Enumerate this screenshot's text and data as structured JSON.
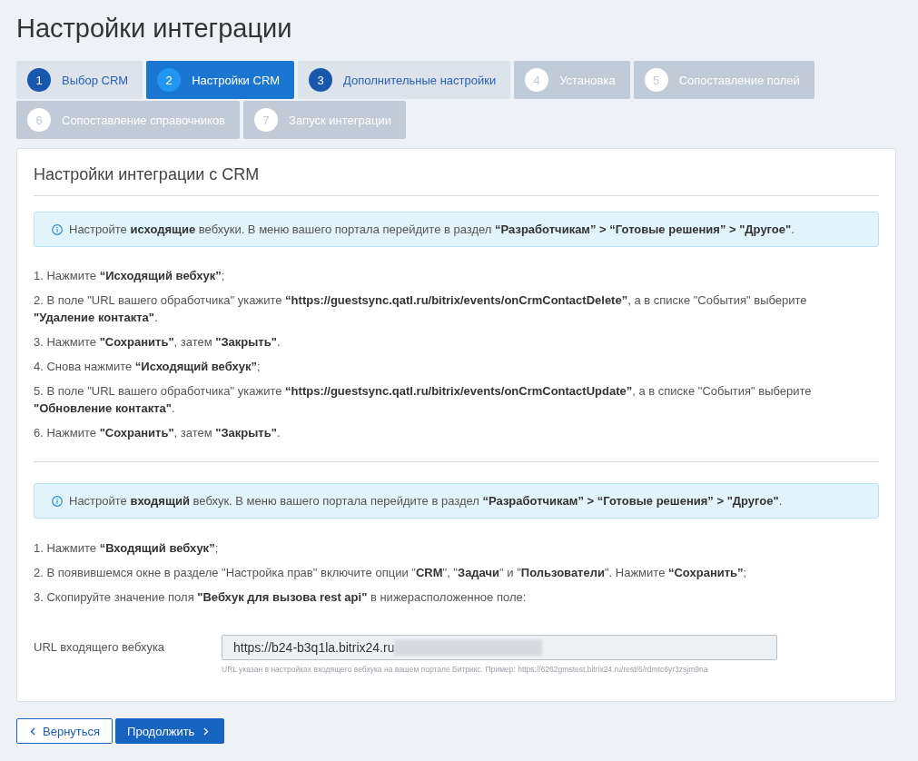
{
  "page": {
    "title": "Настройки интеграции"
  },
  "tabs": [
    {
      "number": "1",
      "label": "Выбор CRM",
      "selected": false,
      "disabled": false
    },
    {
      "number": "2",
      "label": "Настройки CRM",
      "selected": true,
      "disabled": false
    },
    {
      "number": "3",
      "label": "Дополнительные настройки",
      "selected": false,
      "disabled": false
    },
    {
      "number": "4",
      "label": "Установка",
      "selected": false,
      "disabled": true
    },
    {
      "number": "5",
      "label": "Сопоставление полей",
      "selected": false,
      "disabled": true
    },
    {
      "number": "6",
      "label": "Сопоставление справочников",
      "selected": false,
      "disabled": true
    },
    {
      "number": "7",
      "label": "Запуск интеграции",
      "selected": false,
      "disabled": true
    }
  ],
  "card": {
    "title": "Настройки интеграции с CRM",
    "sections": [
      {
        "notice": "Настройте **исходящие** вебхуки. В меню вашего портала перейдите в раздел **“Разработчикам” > “Готовые решения” > \"Другое\"**.",
        "steps": [
          "1. Нажмите **“Исходящий вебхук”**;",
          "2. В поле \"URL вашего обработчика\" укажите **“https://guestsync.qatl.ru/bitrix/events/onCrmContactDelete”**, а в списке \"События\" выберите **\"Удаление контакта\"**.",
          "3. Нажмите **\"Сохранить\"**, затем **\"Закрыть\"**.",
          "4. Снова нажмите **“Исходящий вебхук”**;",
          "5. В поле \"URL вашего обработчика\" укажите **“https://guestsync.qatl.ru/bitrix/events/onCrmContactUpdate”**, а в списке \"События\" выберите **\"Обновление контакта\"**.",
          "6. Нажмите **\"Сохранить\"**, затем **\"Закрыть\"**."
        ]
      },
      {
        "notice": "Настройте **входящий** вебхук. В меню вашего портала перейдите в раздел **“Разработчикам” > “Готовые решения” > \"Другое\"**.",
        "steps": [
          "1. Нажмите **“Входящий вебхук”**;",
          "2. В появившемся окне в разделе \"Настройка прав\" включите опции \"**CRM**\", \"**Задачи**\" и \"**Пользователи**\". Нажмите **“Сохранить”**;",
          "3. Скопируйте значение поля **\"Вебхук для вызова rest api\"** в нижерасположенное поле:"
        ]
      }
    ],
    "field": {
      "label": "URL входящего вебхука",
      "value": "https://b24-b3q1la.bitrix24.ru",
      "redacted": true,
      "readonly": true,
      "hint": "URL указан в настройках входящего вебхука на вашем портале Битрикс. Пример: https://6262gmstest.bitrix24.ru/rest/6/rdmtc6yr3zsjm9na"
    }
  },
  "buttons": [
    {
      "label": "Вернуться",
      "kind": "back"
    },
    {
      "label": "Продолжить",
      "kind": "next"
    }
  ]
}
